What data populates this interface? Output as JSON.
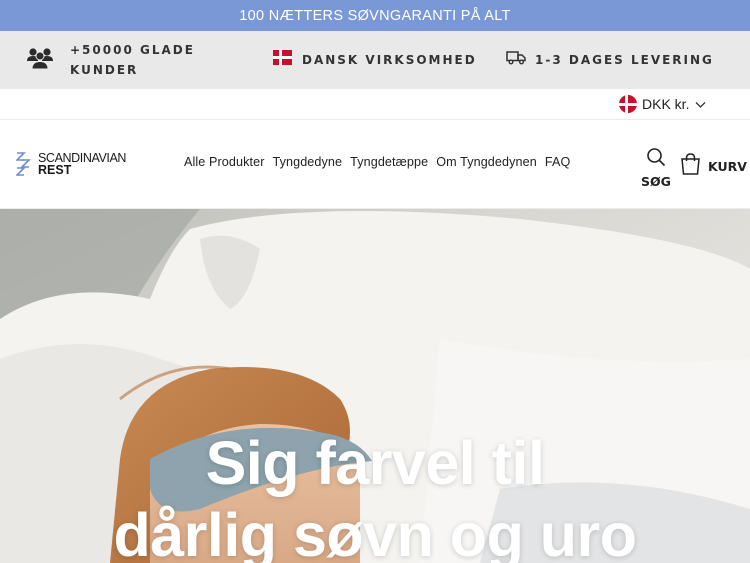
{
  "announcement": "100 NÆTTERS SØVNGARANTI PÅ ALT",
  "usps": [
    {
      "icon": "customers-group-icon",
      "line1": "+50000 GLADE",
      "line2": "KUNDER"
    },
    {
      "icon": "danish-flag-icon",
      "text": "DANSK VIRKSOMHED"
    },
    {
      "icon": "delivery-truck-icon",
      "text": "1-3 DAGES LEVERING"
    }
  ],
  "currency": {
    "icon": "danish-flag-icon",
    "label": "DKK kr."
  },
  "logo": {
    "line1": "SCANDINAVIAN",
    "line2": "REST",
    "mark": "Zzz"
  },
  "nav": [
    "Alle Produkter",
    "Tyngdedyne",
    "Tyngdetæppe",
    "Om Tyngdedynen",
    "FAQ"
  ],
  "search": {
    "label": "SØG",
    "icon": "search-icon"
  },
  "cart": {
    "label": "KURV",
    "icon": "shopping-bag-icon"
  },
  "hero": {
    "line1": "Sig farvel til",
    "line2": "dårlig søvn og uro",
    "image": "woman-sleeping-with-eye-mask"
  },
  "colors": {
    "announcement_bg": "#7b98d6",
    "usp_bg": "#e9e9e9",
    "logo_accent": "#6b8ed6",
    "danish_red": "#c8102e"
  }
}
